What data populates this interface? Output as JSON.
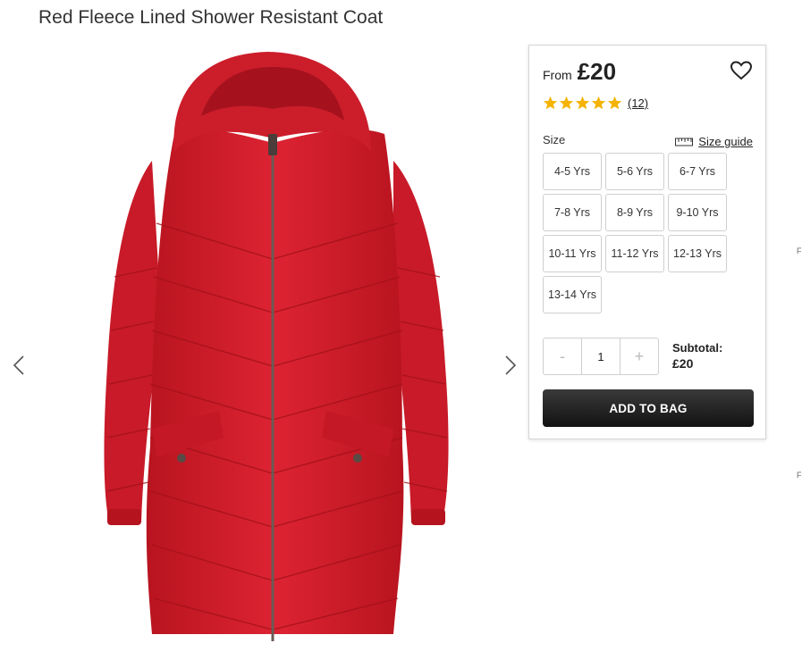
{
  "product": {
    "title": "Red Fleece Lined Shower Resistant Coat",
    "image_alt": "Red Fleece Lined Shower Resistant Coat"
  },
  "gallery": {
    "prev_icon": "chevron-left-icon",
    "next_icon": "chevron-right-icon"
  },
  "buy_panel": {
    "price_prefix": "From",
    "price": "£20",
    "rating": {
      "stars": 5,
      "max": 5,
      "review_count": "(12)",
      "star_color": "#f5b301"
    },
    "size_label": "Size",
    "size_guide_label": "Size guide",
    "sizes": [
      "4-5 Yrs",
      "5-6 Yrs",
      "6-7 Yrs",
      "7-8 Yrs",
      "8-9 Yrs",
      "9-10 Yrs",
      "10-11 Yrs",
      "11-12 Yrs",
      "12-13 Yrs",
      "13-14 Yrs"
    ],
    "quantity": {
      "minus": "-",
      "value": "1",
      "plus": "+"
    },
    "subtotal_label": "Subtotal:",
    "subtotal_value": "£20",
    "add_to_bag_label": "ADD TO BAG"
  },
  "edge_fragments": [
    "F",
    "F"
  ],
  "colors": {
    "coat": "#d81e2e",
    "button_dark": "#1a1a1a"
  }
}
